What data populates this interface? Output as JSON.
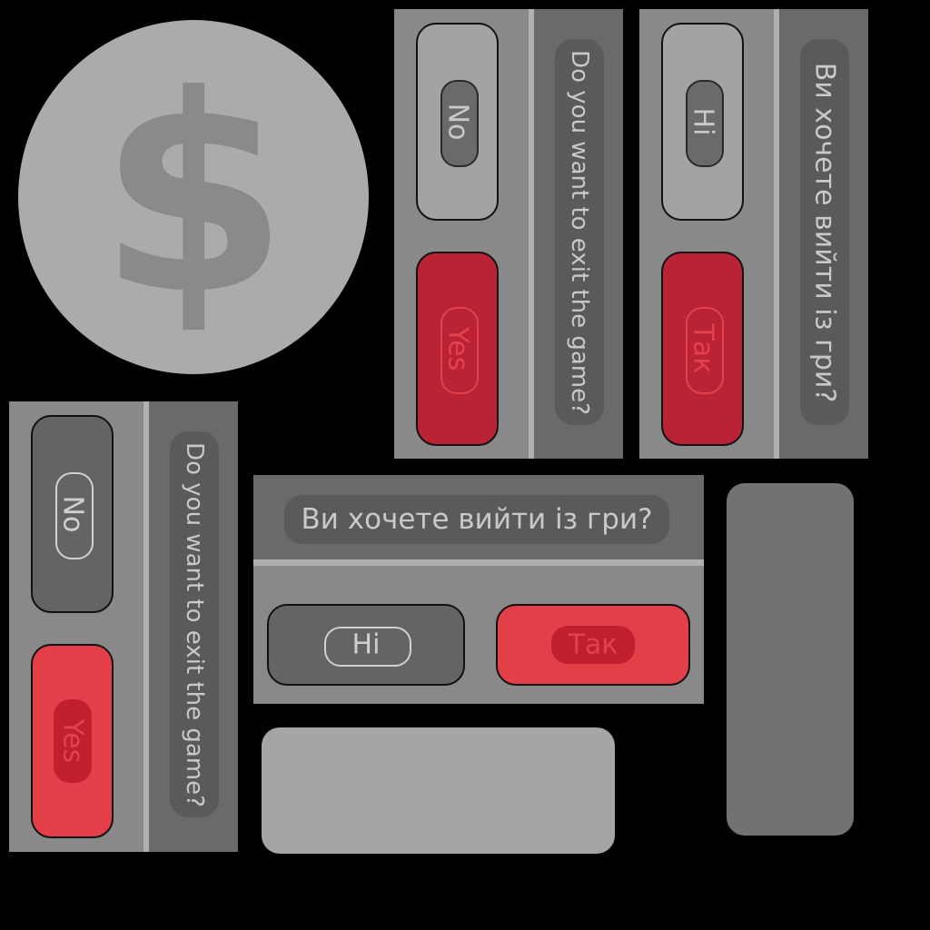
{
  "coin": {
    "symbol": "$",
    "icon": "dollar-coin-icon"
  },
  "panel_en": {
    "question": "Do you want to exit the game?",
    "no_label": "No",
    "yes_label": "Yes"
  },
  "panel_uk": {
    "question": "Ви хочете вийти із гри?",
    "no_label": "Ні",
    "yes_label": "Так"
  },
  "panel_en_hover": {
    "question": "Do you want to exit the game?",
    "no_label": "No",
    "yes_label": "Yes"
  },
  "panel_uk_horizontal": {
    "question": "Ви хочете вийти із гри?",
    "no_label": "Ні",
    "yes_label": "Так"
  },
  "colors": {
    "background": "#000000",
    "panel": "#8a898a",
    "panel_dark": "#6b6a6a",
    "yes_red": "#ba2235",
    "yes_red_light": "#e23f48",
    "text": "#c9c9c9"
  }
}
